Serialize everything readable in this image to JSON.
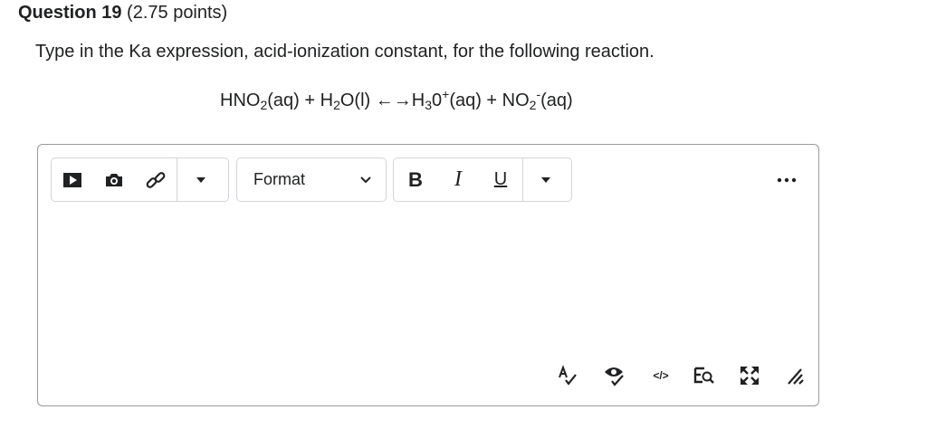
{
  "question": {
    "number_label": "Question 19",
    "points_label": "(2.75 points)",
    "prompt": "Type in the Ka expression, acid-ionization constant, for the following reaction.",
    "equation": {
      "p1": "HNO",
      "p1_sub": "2",
      "p2": "(aq) + H",
      "p2_sub": "2",
      "p3": "O(l) ",
      "arrow": "←→",
      "p4": "H",
      "p4_sub": "3",
      "p5": "0",
      "p5_sup": "+",
      "p6": "(aq) + NO",
      "p6_sub": "2",
      "p6_sup": "-",
      "p7": "(aq)"
    }
  },
  "toolbar": {
    "format_label": "Format",
    "bold_label": "B",
    "italic_label": "I",
    "underline_label": "U",
    "icons": [
      "insert-stuff-icon",
      "camera-icon",
      "link-icon",
      "dropdown-icon",
      "chevron-down-icon",
      "dropdown-icon",
      "more-icon"
    ]
  },
  "bottom_toolbar": {
    "icons": [
      "spellcheck-icon",
      "accessibility-checker-icon",
      "source-code-icon",
      "preview-icon",
      "fullscreen-icon",
      "resize-handle-icon"
    ],
    "source_label": "</>"
  },
  "colors": {
    "text": "#202122",
    "border": "#9a9a9a",
    "group_border": "#d3d5d8"
  }
}
